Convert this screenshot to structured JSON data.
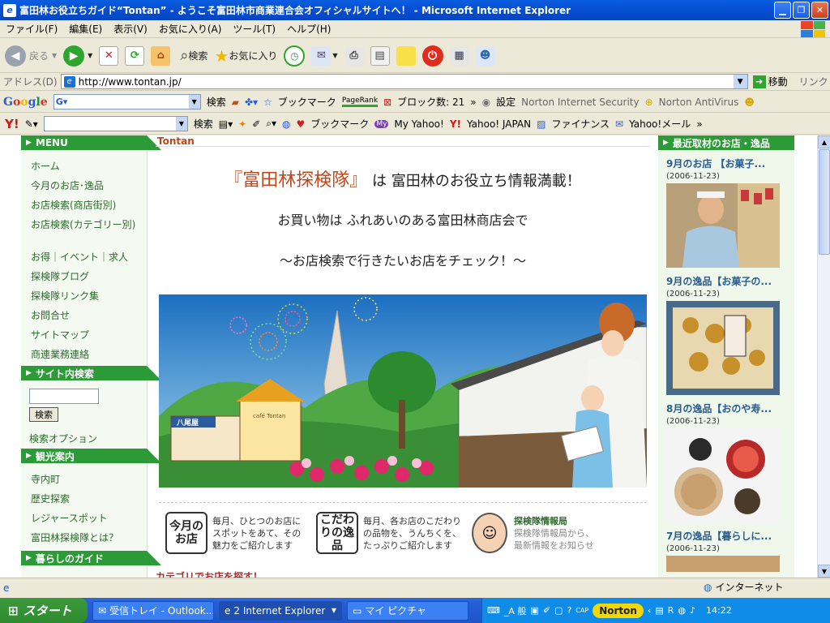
{
  "window": {
    "title": "富田林お役立ちガイド“Tontan” - ようこそ富田林市商業連合会オフィシャルサイトへ！ - Microsoft Internet Explorer"
  },
  "menubar": [
    "ファイル(F)",
    "編集(E)",
    "表示(V)",
    "お気に入り(A)",
    "ツール(T)",
    "ヘルプ(H)"
  ],
  "toolbar": {
    "back": "戻る",
    "search": "検索",
    "favorites": "お気に入り"
  },
  "address": {
    "label": "アドレス(D)",
    "url": "http://www.tontan.jp/",
    "go": "移動",
    "links": "リンク"
  },
  "google_bar": {
    "logo": "Google",
    "search": "検索",
    "bookmarks": "ブックマーク",
    "pagerank": "PageRank",
    "blocked": "ブロック数: 21",
    "settings": "設定",
    "norton_security": "Norton Internet Security",
    "norton_antivirus": "Norton AntiVirus"
  },
  "yahoo_bar": {
    "search": "検索",
    "bookmarks": "ブックマーク",
    "my_yahoo": "My Yahoo!",
    "yahoo_japan": "Yahoo! JAPAN",
    "finance": "ファイナンス",
    "mail": "Yahoo!メール"
  },
  "sidebar": {
    "menu_title": "MENU",
    "menu": [
      "ホーム",
      "今月のお店･逸品",
      "お店検索(商店街別)",
      "お店検索(カテゴリー別)",
      "お得｜イベント｜求人",
      "探検隊ブログ",
      "探検隊リンク集",
      "お問合せ",
      "サイトマップ",
      "商連業務連絡"
    ],
    "search_title": "サイト内検索",
    "search_button": "検索",
    "search_options": "検索オプション",
    "tourism_title": "観光案内",
    "tourism": [
      "寺内町",
      "歴史探索",
      "レジャースポット",
      "富田林探検隊とは？"
    ],
    "living_title": "暮らしのガイド"
  },
  "main": {
    "brand": "Tontan",
    "headline_red": "『富田林探検隊』",
    "headline_rest": "は 富田林のお役立ち情報満載！",
    "line2": "お買い物は ふれあいのある富田林商店会で",
    "line3": "〜お店検索で行きたいお店をチェック！〜",
    "feature1_logo": "今月のお店",
    "feature1_text": "毎月、ひとつのお店に\nスポットをあて、その\n魅力をご紹介します",
    "feature2_logo": "こだわりの逸品",
    "feature2_text": "毎月、各お店のこだわり\nの品物を、うんちくを、\nたっぷりご紹介します",
    "feature3_title": "探検隊情報局",
    "feature3_text": "探検隊情報局から、\n最新情報をお知らせ",
    "category_heading": "カテゴリでお店を探す！",
    "banner_signs": [
      "八尾屋",
      "café Tontan"
    ]
  },
  "right": {
    "title": "最近取材のお店・逸品",
    "items": [
      {
        "title": "9月のお店 【お菓子...",
        "date": "(2006-11-23)"
      },
      {
        "title": "9月の逸品【お菓子の...",
        "date": "(2006-11-23)"
      },
      {
        "title": "8月の逸品【おのや寿...",
        "date": "(2006-11-23)"
      },
      {
        "title": "7月の逸品【暮らしに...",
        "date": "(2006-11-23)"
      }
    ]
  },
  "status": {
    "zone": "インターネット"
  },
  "taskbar": {
    "start": "スタート",
    "tasks": [
      "受信トレイ - Outlook...",
      "2 Internet Explorer",
      "マイ ピクチャ"
    ],
    "norton": "Norton",
    "ime": "_A 般",
    "clock": "14:22"
  }
}
